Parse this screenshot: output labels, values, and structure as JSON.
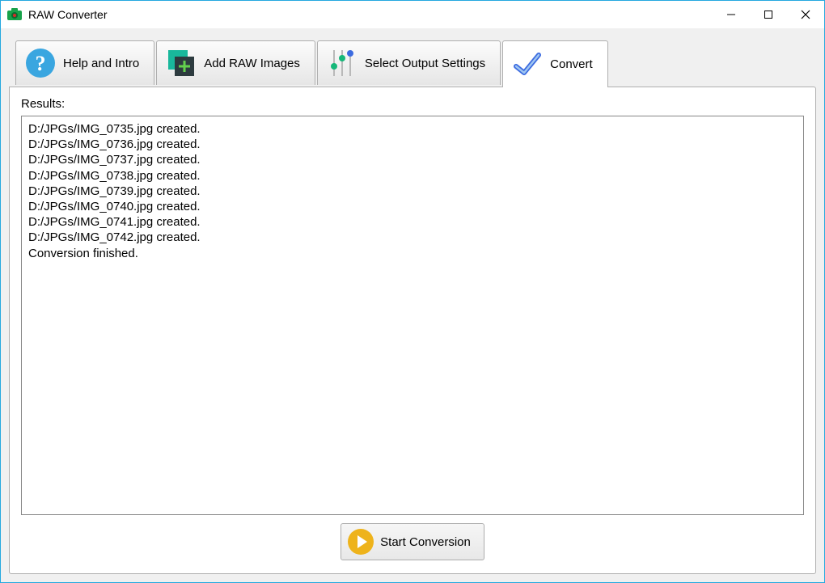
{
  "window": {
    "title": "RAW Converter"
  },
  "tabs": {
    "help": {
      "label": "Help and Intro"
    },
    "add": {
      "label": "Add RAW Images"
    },
    "output": {
      "label": "Select Output Settings"
    },
    "convert": {
      "label": "Convert"
    }
  },
  "results": {
    "label": "Results:",
    "lines": [
      "D:/JPGs/IMG_0735.jpg created.",
      "D:/JPGs/IMG_0736.jpg created.",
      "D:/JPGs/IMG_0737.jpg created.",
      "D:/JPGs/IMG_0738.jpg created.",
      "D:/JPGs/IMG_0739.jpg created.",
      "D:/JPGs/IMG_0740.jpg created.",
      "D:/JPGs/IMG_0741.jpg created.",
      "D:/JPGs/IMG_0742.jpg created.",
      "Conversion finished."
    ]
  },
  "buttons": {
    "start": "Start Conversion"
  }
}
